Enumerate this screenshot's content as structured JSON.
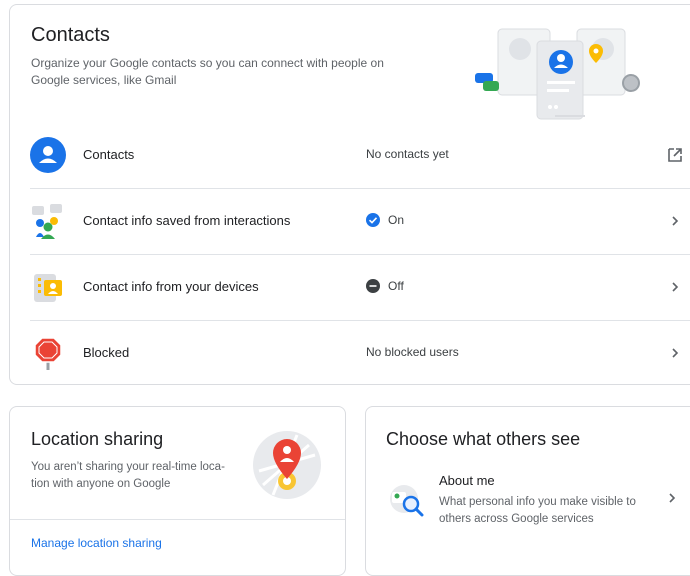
{
  "contacts_section": {
    "title": "Contacts",
    "description": "Organize your Google contacts so you can connect with people on Google services, like Gmail",
    "rows": [
      {
        "label": "Contacts",
        "value": "No contacts yet",
        "icon": "person-icon",
        "action_icon": "open-in-new-icon"
      },
      {
        "label": "Contact info saved from interactions",
        "value": "On",
        "icon": "interactions-icon",
        "status_icon": "check-circle-icon",
        "action_icon": "chevron-right-icon"
      },
      {
        "label": "Contact info from your devices",
        "value": "Off",
        "icon": "device-contacts-icon",
        "status_icon": "minus-circle-icon",
        "action_icon": "chevron-right-icon"
      },
      {
        "label": "Blocked",
        "value": "No blocked users",
        "icon": "stop-sign-icon",
        "action_icon": "chevron-right-icon"
      }
    ]
  },
  "location_section": {
    "title": "Location sharing",
    "description": "You aren’t sharing your real-time loca-tion with anyone on Google",
    "link": "Manage location sharing"
  },
  "choose_section": {
    "title": "Choose what others see",
    "item_title": "About me",
    "item_description": "What personal info you make visible to others across Google services"
  },
  "colors": {
    "accent": "#1a73e8",
    "text": "#202124",
    "secondary_text": "#5f6368",
    "border": "#dadce0"
  }
}
